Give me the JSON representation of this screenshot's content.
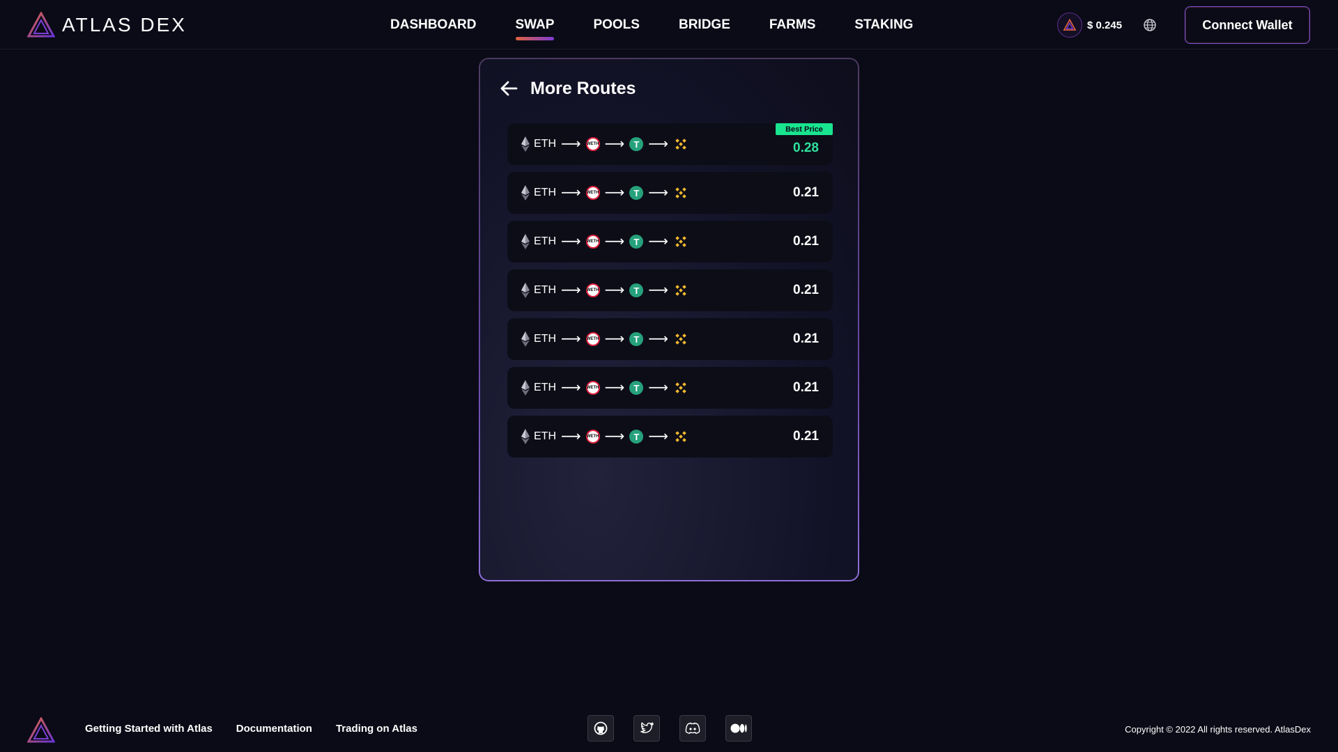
{
  "header": {
    "brand": "ATLAS DEX",
    "nav": [
      {
        "label": "DASHBOARD",
        "active": false
      },
      {
        "label": "SWAP",
        "active": true
      },
      {
        "label": "POOLS",
        "active": false
      },
      {
        "label": "BRIDGE",
        "active": false
      },
      {
        "label": "FARMS",
        "active": false
      },
      {
        "label": "STAKING",
        "active": false
      }
    ],
    "token_price": "$ 0.245",
    "connect_label": "Connect Wallet"
  },
  "panel": {
    "title": "More Routes",
    "best_badge": "Best Price",
    "routes": [
      {
        "from": "ETH",
        "value": "0.28",
        "best": true
      },
      {
        "from": "ETH",
        "value": "0.21",
        "best": false
      },
      {
        "from": "ETH",
        "value": "0.21",
        "best": false
      },
      {
        "from": "ETH",
        "value": "0.21",
        "best": false
      },
      {
        "from": "ETH",
        "value": "0.21",
        "best": false
      },
      {
        "from": "ETH",
        "value": "0.21",
        "best": false
      },
      {
        "from": "ETH",
        "value": "0.21",
        "best": false
      }
    ],
    "route_icons": [
      "eth-icon",
      "weth-icon",
      "usdt-icon",
      "bnb-icon"
    ]
  },
  "footer": {
    "links": [
      "Getting Started with Atlas",
      "Documentation",
      "Trading on Atlas"
    ],
    "socials": [
      "github-icon",
      "twitter-icon",
      "discord-icon",
      "medium-icon"
    ],
    "copyright": "Copyright © 2022 All rights reserved. AtlasDex"
  },
  "colors": {
    "background": "#0b0b17",
    "best_value": "#2ee39c",
    "best_badge": "#19e48f",
    "accent_start": "#e0623e",
    "accent_end": "#7e3bd6"
  }
}
